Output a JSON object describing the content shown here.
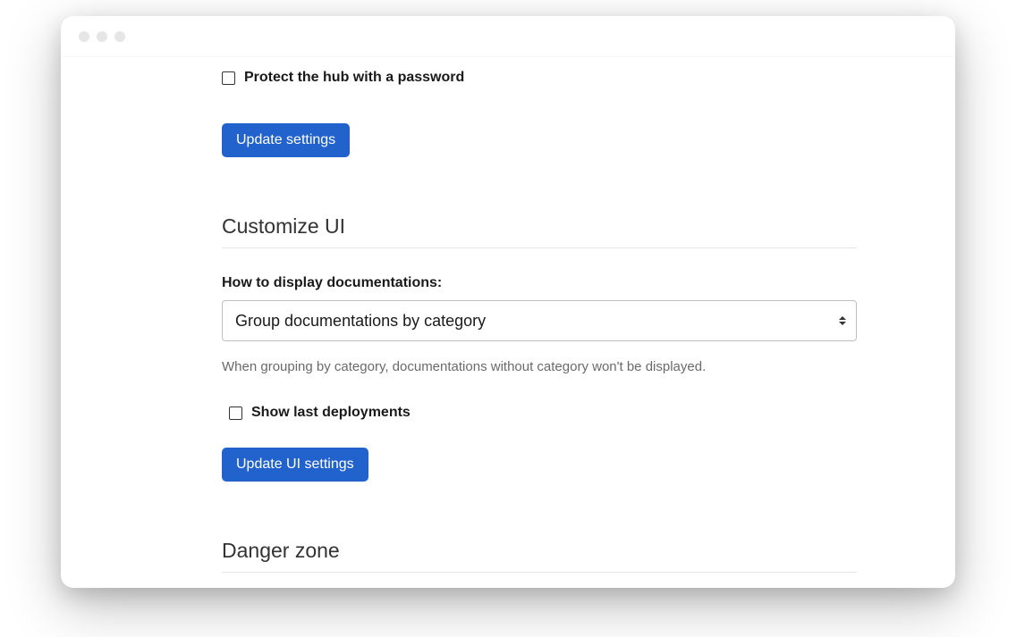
{
  "protect": {
    "checkbox_label": "Protect the hub with a password",
    "update_button": "Update settings"
  },
  "customize": {
    "heading": "Customize UI",
    "display_label": "How to display documentations:",
    "display_selected": "Group documentations by category",
    "help_text": "When grouping by category, documentations without category won't be displayed.",
    "show_last_label": "Show last deployments",
    "update_button": "Update UI settings"
  },
  "danger": {
    "heading": "Danger zone"
  }
}
